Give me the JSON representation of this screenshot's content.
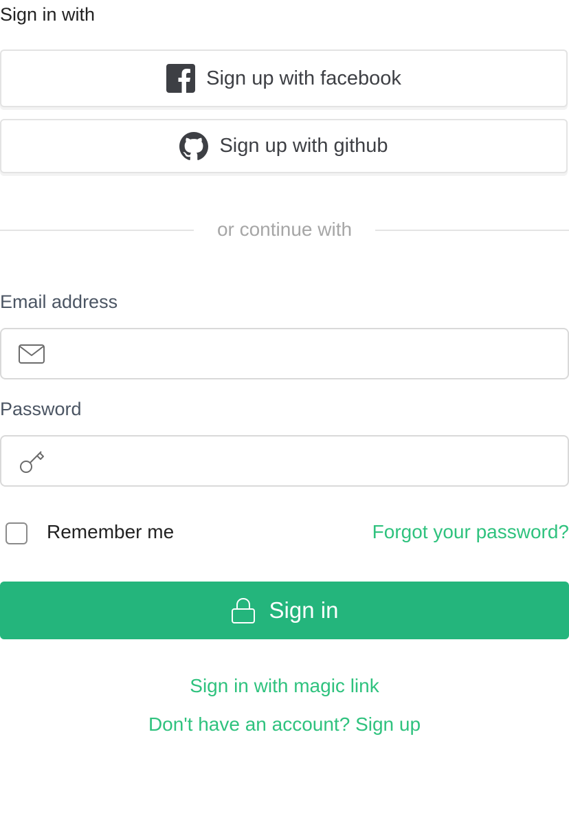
{
  "heading": "Sign in with",
  "social": {
    "facebook": {
      "label": "Sign up with facebook",
      "icon": "facebook-icon"
    },
    "github": {
      "label": "Sign up with github",
      "icon": "github-icon"
    }
  },
  "divider": {
    "text": "or continue with"
  },
  "email": {
    "label": "Email address",
    "value": "",
    "placeholder": "",
    "icon": "mail-icon"
  },
  "password": {
    "label": "Password",
    "value": "",
    "placeholder": "",
    "icon": "key-icon"
  },
  "remember": {
    "label": "Remember me",
    "checked": false
  },
  "forgot": {
    "label": "Forgot your password?"
  },
  "signin": {
    "label": "Sign in",
    "icon": "lock-icon"
  },
  "links": {
    "magic": "Sign in with magic link",
    "signup": "Don't have an account? Sign up"
  },
  "colors": {
    "accent": "#24b57c",
    "link": "#2fc27e",
    "muted": "#a6a6a6",
    "text": "#222222"
  }
}
